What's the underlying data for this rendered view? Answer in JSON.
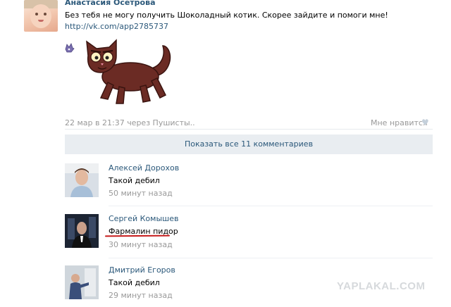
{
  "post": {
    "author": "Анастасия Осетрова",
    "text": "Без тебя не могу получить Шоколадный котик. Скорее зайдите и помоги мне!",
    "link": "http://vk.com/app2785737",
    "meta": "22 мар в 21:37 через Пушисты..",
    "like_label": "Мне нравится"
  },
  "show_all_comments": "Показать все 11 комментариев",
  "comments": [
    {
      "name": "Алексей Дорохов",
      "text": "Такой дебил",
      "time": "50 минут назад"
    },
    {
      "name": "Сергей Комышев",
      "text": "Фармалин пидор",
      "time": "30 минут назад"
    },
    {
      "name": "Дмитрий Егоров",
      "text": "Такой дебил",
      "time": "29 минут назад"
    }
  ],
  "watermark": "YAPLAKAL.COM",
  "colors": {
    "link": "#2b587a",
    "muted": "#999999",
    "button_bg": "#e9edf1",
    "underline": "#c71b1b"
  }
}
